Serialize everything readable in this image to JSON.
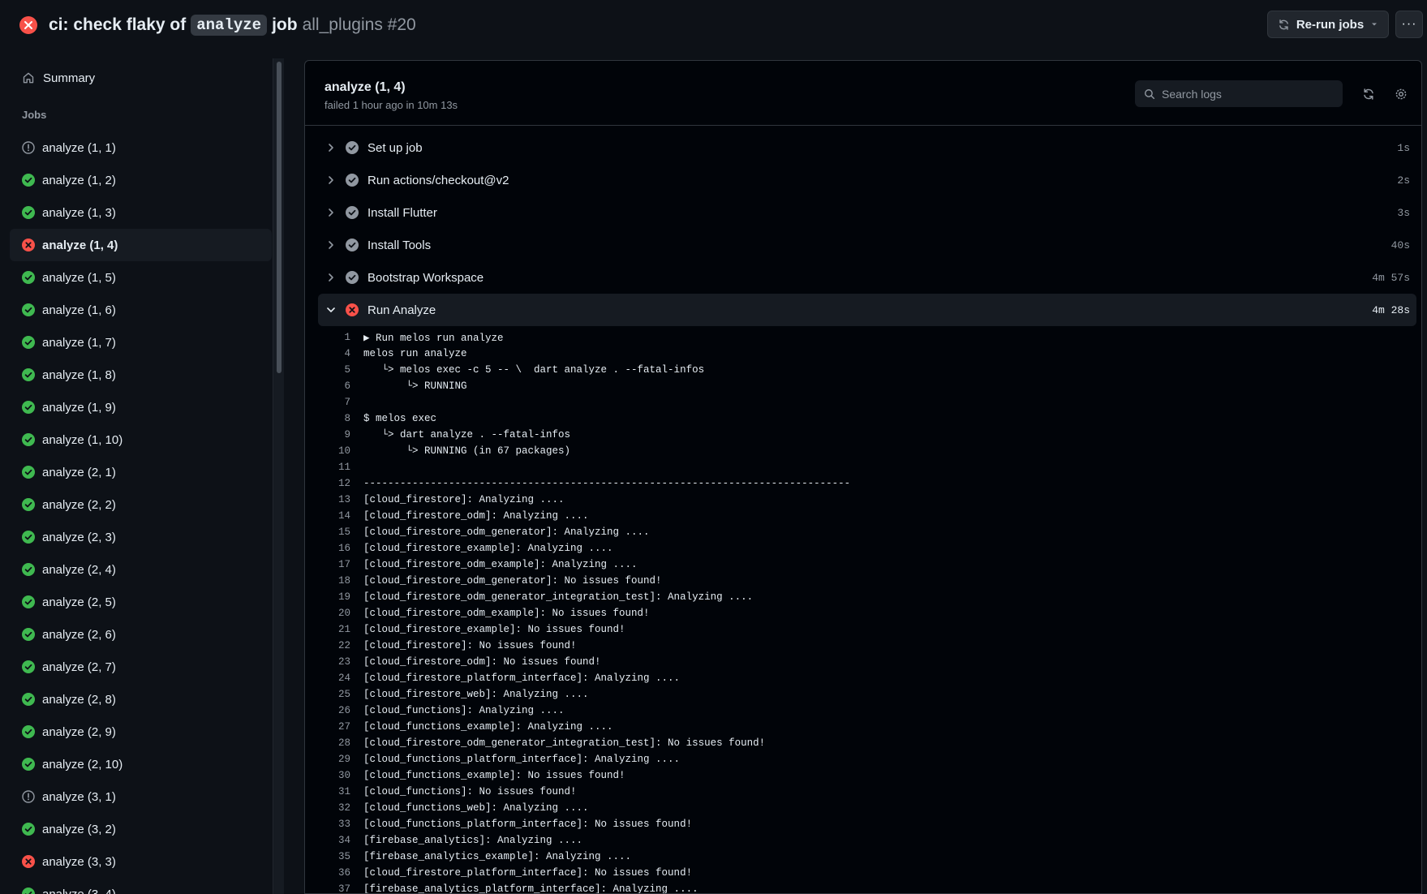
{
  "header": {
    "title_part1": "ci: check flaky of",
    "title_code": "analyze",
    "title_part2": "job",
    "workflow": "all_plugins #20",
    "rerun_label": "Re-run jobs",
    "more_label": "···"
  },
  "sidebar": {
    "summary_label": "Summary",
    "jobs_label": "Jobs",
    "jobs": [
      {
        "label": "analyze (1, 1)",
        "status": "warning"
      },
      {
        "label": "analyze (1, 2)",
        "status": "success"
      },
      {
        "label": "analyze (1, 3)",
        "status": "success"
      },
      {
        "label": "analyze (1, 4)",
        "status": "failure",
        "active": true
      },
      {
        "label": "analyze (1, 5)",
        "status": "success"
      },
      {
        "label": "analyze (1, 6)",
        "status": "success"
      },
      {
        "label": "analyze (1, 7)",
        "status": "success"
      },
      {
        "label": "analyze (1, 8)",
        "status": "success"
      },
      {
        "label": "analyze (1, 9)",
        "status": "success"
      },
      {
        "label": "analyze (1, 10)",
        "status": "success"
      },
      {
        "label": "analyze (2, 1)",
        "status": "success"
      },
      {
        "label": "analyze (2, 2)",
        "status": "success"
      },
      {
        "label": "analyze (2, 3)",
        "status": "success"
      },
      {
        "label": "analyze (2, 4)",
        "status": "success"
      },
      {
        "label": "analyze (2, 5)",
        "status": "success"
      },
      {
        "label": "analyze (2, 6)",
        "status": "success"
      },
      {
        "label": "analyze (2, 7)",
        "status": "success"
      },
      {
        "label": "analyze (2, 8)",
        "status": "success"
      },
      {
        "label": "analyze (2, 9)",
        "status": "success"
      },
      {
        "label": "analyze (2, 10)",
        "status": "success"
      },
      {
        "label": "analyze (3, 1)",
        "status": "warning"
      },
      {
        "label": "analyze (3, 2)",
        "status": "success"
      },
      {
        "label": "analyze (3, 3)",
        "status": "failure"
      },
      {
        "label": "analyze (3, 4)",
        "status": "success"
      }
    ]
  },
  "job": {
    "title": "analyze (1, 4)",
    "subtitle": "failed 1 hour ago in 10m 13s",
    "search_placeholder": "Search logs"
  },
  "steps": [
    {
      "label": "Set up job",
      "duration": "1s",
      "status": "done",
      "expanded": false
    },
    {
      "label": "Run actions/checkout@v2",
      "duration": "2s",
      "status": "done",
      "expanded": false
    },
    {
      "label": "Install Flutter",
      "duration": "3s",
      "status": "done",
      "expanded": false
    },
    {
      "label": "Install Tools",
      "duration": "40s",
      "status": "done",
      "expanded": false
    },
    {
      "label": "Bootstrap Workspace",
      "duration": "4m 57s",
      "status": "done",
      "expanded": false
    },
    {
      "label": "Run Analyze",
      "duration": "4m 28s",
      "status": "failure",
      "expanded": true
    }
  ],
  "log": [
    {
      "n": "1",
      "t": "▶ Run melos run analyze"
    },
    {
      "n": "4",
      "t": "melos run analyze"
    },
    {
      "n": "5",
      "t": "   └> melos exec -c 5 -- \\  dart analyze . --fatal-infos"
    },
    {
      "n": "6",
      "t": "       └> RUNNING"
    },
    {
      "n": "7",
      "t": ""
    },
    {
      "n": "8",
      "t": "$ melos exec"
    },
    {
      "n": "9",
      "t": "   └> dart analyze . --fatal-infos"
    },
    {
      "n": "10",
      "t": "       └> RUNNING (in 67 packages)"
    },
    {
      "n": "11",
      "t": ""
    },
    {
      "n": "12",
      "t": "--------------------------------------------------------------------------------"
    },
    {
      "n": "13",
      "t": "[cloud_firestore]: Analyzing ...."
    },
    {
      "n": "14",
      "t": "[cloud_firestore_odm]: Analyzing ...."
    },
    {
      "n": "15",
      "t": "[cloud_firestore_odm_generator]: Analyzing ...."
    },
    {
      "n": "16",
      "t": "[cloud_firestore_example]: Analyzing ...."
    },
    {
      "n": "17",
      "t": "[cloud_firestore_odm_example]: Analyzing ...."
    },
    {
      "n": "18",
      "t": "[cloud_firestore_odm_generator]: No issues found!"
    },
    {
      "n": "19",
      "t": "[cloud_firestore_odm_generator_integration_test]: Analyzing ...."
    },
    {
      "n": "20",
      "t": "[cloud_firestore_odm_example]: No issues found!"
    },
    {
      "n": "21",
      "t": "[cloud_firestore_example]: No issues found!"
    },
    {
      "n": "22",
      "t": "[cloud_firestore]: No issues found!"
    },
    {
      "n": "23",
      "t": "[cloud_firestore_odm]: No issues found!"
    },
    {
      "n": "24",
      "t": "[cloud_firestore_platform_interface]: Analyzing ...."
    },
    {
      "n": "25",
      "t": "[cloud_firestore_web]: Analyzing ...."
    },
    {
      "n": "26",
      "t": "[cloud_functions]: Analyzing ...."
    },
    {
      "n": "27",
      "t": "[cloud_functions_example]: Analyzing ...."
    },
    {
      "n": "28",
      "t": "[cloud_firestore_odm_generator_integration_test]: No issues found!"
    },
    {
      "n": "29",
      "t": "[cloud_functions_platform_interface]: Analyzing ...."
    },
    {
      "n": "30",
      "t": "[cloud_functions_example]: No issues found!"
    },
    {
      "n": "31",
      "t": "[cloud_functions]: No issues found!"
    },
    {
      "n": "32",
      "t": "[cloud_functions_web]: Analyzing ...."
    },
    {
      "n": "33",
      "t": "[cloud_functions_platform_interface]: No issues found!"
    },
    {
      "n": "34",
      "t": "[firebase_analytics]: Analyzing ...."
    },
    {
      "n": "35",
      "t": "[firebase_analytics_example]: Analyzing ...."
    },
    {
      "n": "36",
      "t": "[cloud_firestore_platform_interface]: No issues found!"
    },
    {
      "n": "37",
      "t": "[firebase_analytics_platform_interface]: Analyzing ...."
    }
  ],
  "colors": {
    "success": "#3fb950",
    "failure": "#f85149",
    "neutral": "#9198a1",
    "background": "#0d1117"
  }
}
